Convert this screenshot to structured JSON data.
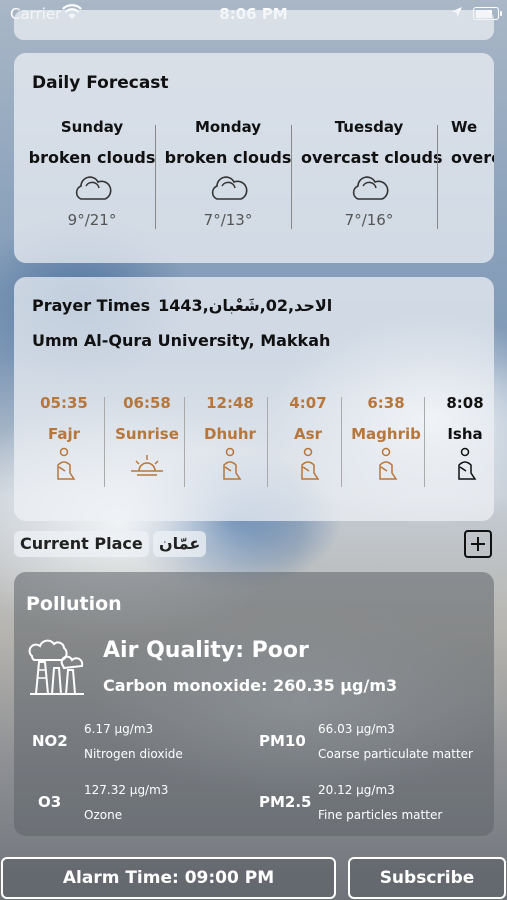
{
  "status_bar": {
    "carrier": "Carrier",
    "time": "8:06 PM"
  },
  "daily_forecast": {
    "heading": "Daily Forecast",
    "days": [
      {
        "name": "Sunday",
        "desc": "broken clouds",
        "temp": "9°/21°"
      },
      {
        "name": "Monday",
        "desc": "broken clouds",
        "temp": "7°/13°"
      },
      {
        "name": "Tuesday",
        "desc": "overcast clouds",
        "temp": "7°/16°"
      },
      {
        "name": "We",
        "desc": "overc",
        "temp": ""
      }
    ],
    "icon": "cloud-icon"
  },
  "prayer_times": {
    "title": "Prayer Times",
    "hijri_date": "الاحد,02,شَعْبان,1443",
    "method": "Umm Al-Qura University, Makkah",
    "prayers": [
      {
        "time": "05:35",
        "name": "Fajr",
        "icon": "praying-person-icon"
      },
      {
        "time": "06:58",
        "name": "Sunrise",
        "icon": "sunrise-icon"
      },
      {
        "time": "12:48",
        "name": "Dhuhr",
        "icon": "praying-person-icon"
      },
      {
        "time": "4:07",
        "name": "Asr",
        "icon": "praying-person-icon"
      },
      {
        "time": "6:38",
        "name": "Maghrib",
        "icon": "praying-person-icon"
      },
      {
        "time": "8:08",
        "name": "Isha",
        "icon": "praying-person-icon"
      }
    ],
    "accent_color": "#b7763a"
  },
  "places": {
    "current": "Current Place",
    "city": "عمّان"
  },
  "pollution": {
    "title": "Pollution",
    "air_quality": "Air Quality: Poor",
    "main_pollutant": "Carbon monoxide: 260.35 µg/m3",
    "items": [
      {
        "symbol": "NO2",
        "value": "6.17 µg/m3",
        "name": "Nitrogen dioxide"
      },
      {
        "symbol": "PM10",
        "value": "66.03 µg/m3",
        "name": "Coarse particulate matter"
      },
      {
        "symbol": "O3",
        "value": "127.32 µg/m3",
        "name": "Ozone"
      },
      {
        "symbol": "PM2.5",
        "value": "20.12 µg/m3",
        "name": "Fine particles matter"
      }
    ]
  },
  "buttons": {
    "alarm": "Alarm Time: 09:00 PM",
    "subscribe": "Subscribe"
  }
}
